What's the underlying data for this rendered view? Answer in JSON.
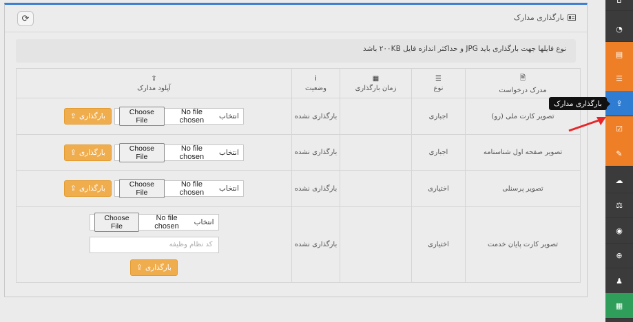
{
  "panel": {
    "title": "بارگذاری مدارک",
    "refresh_icon": "refresh-icon",
    "note": "نوع فایلها جهت بارگذاری باید JPG و حداکثر اندازه فایل ۲۰۰KB باشد"
  },
  "table": {
    "headers": {
      "document": "مدرک درخواست",
      "type": "نوع",
      "upload_time": "زمان بارگذاری",
      "status": "وضعیت",
      "upload": "آپلود مدارک"
    },
    "rows": [
      {
        "document": "تصویر کارت ملی (رو)",
        "type": "اجباری",
        "upload_time": "",
        "status": "بارگذاری نشده"
      },
      {
        "document": "تصویر صفحه اول شناسنامه",
        "type": "اجباری",
        "upload_time": "",
        "status": "بارگذاری نشده"
      },
      {
        "document": "تصویر پرسنلی",
        "type": "اختیاری",
        "upload_time": "",
        "status": "بارگذاری نشده"
      },
      {
        "document": "تصویر کارت پایان خدمت",
        "type": "اختیاری",
        "upload_time": "",
        "status": "بارگذاری نشده"
      }
    ],
    "file_input": {
      "choose_label": "Choose File",
      "status_text": "No file chosen",
      "select_label": "انتخاب"
    },
    "upload_button_label": "بارگذاری",
    "code_placeholder": "کد نظام وظیفه"
  },
  "tooltip": "بارگذاری مدارک",
  "colors": {
    "accent_blue": "#2f7dd3",
    "orange": "#ee7f26",
    "button_orange": "#f0ad4e",
    "green": "#2e9e5a",
    "sidebar": "#3b3b3b"
  },
  "sidebar": {
    "items": [
      {
        "icon": "home-icon",
        "glyph": "⌂"
      },
      {
        "icon": "dashboard-icon",
        "glyph": "◔"
      },
      {
        "icon": "id-card-icon",
        "glyph": "▤"
      },
      {
        "icon": "list-icon",
        "glyph": "☰"
      },
      {
        "icon": "upload-icon",
        "glyph": "⇪"
      },
      {
        "icon": "check-square-icon",
        "glyph": "☑"
      },
      {
        "icon": "edit-icon",
        "glyph": "✎"
      },
      {
        "icon": "cloud-icon",
        "glyph": "☁"
      },
      {
        "icon": "balance-scale-icon",
        "glyph": "⚖"
      },
      {
        "icon": "eye-icon",
        "glyph": "◉"
      },
      {
        "icon": "life-ring-icon",
        "glyph": "⊕"
      },
      {
        "icon": "user-icon",
        "glyph": "♟"
      },
      {
        "icon": "table-icon",
        "glyph": "▦"
      }
    ]
  }
}
